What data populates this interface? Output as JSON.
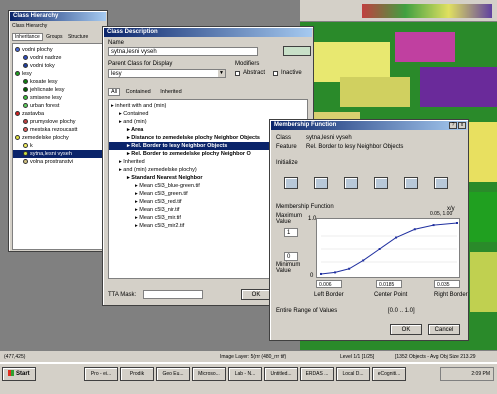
{
  "app": {
    "title": "eCognition - [...]"
  },
  "colors": {
    "titlebar": "#0a246a",
    "panel": "#d4d0c8",
    "highlight": "#0a246a"
  },
  "hierarchy": {
    "title": "Class Hierarchy",
    "menu": [
      "Class Hierarchy",
      "Classes",
      "Nearest Neighbor",
      "Edit"
    ],
    "tabs": [
      "Inheritance",
      "Groups",
      "Structure"
    ],
    "items": [
      {
        "label": "vodni plochy",
        "color": "#4a6ad8",
        "indent": 0
      },
      {
        "label": "vodni nadrze",
        "color": "#3050c0",
        "indent": 1
      },
      {
        "label": "vodni toky",
        "color": "#2040a0",
        "indent": 1
      },
      {
        "label": "lesy",
        "color": "#20a020",
        "indent": 0
      },
      {
        "label": "kosate lesy",
        "color": "#108010",
        "indent": 1
      },
      {
        "label": "jehlicnate lesy",
        "color": "#006000",
        "indent": 1
      },
      {
        "label": "smisene lesy",
        "color": "#40c040",
        "indent": 1
      },
      {
        "label": "urban forest",
        "color": "#60d060",
        "indent": 1
      },
      {
        "label": "zastavba",
        "color": "#d02020",
        "indent": 0
      },
      {
        "label": "prumyslove plochy",
        "color": "#c04040",
        "indent": 1
      },
      {
        "label": "mestska rezoucastt",
        "color": "#e06060",
        "indent": 1
      },
      {
        "label": "zemedelske plochy",
        "color": "#e0e040",
        "indent": 0
      },
      {
        "label": "k",
        "color": "#f0f060",
        "indent": 1
      },
      {
        "label": "sytna,lesni vyseh",
        "color": "#c8e040",
        "indent": 1,
        "selected": true
      },
      {
        "label": "volna prostranstvi",
        "color": "#d0c080",
        "indent": 1
      }
    ]
  },
  "classdesc": {
    "title": "Class Description",
    "name_label": "Name",
    "name_value": "sytna,lesni vyseh",
    "parent_label": "Parent Class for Display",
    "parent_value": "lesy",
    "modifiers_label": "Modifiers",
    "abstract_label": "Abstract",
    "inactive_label": "Inactive",
    "tabs": [
      "All",
      "Contained",
      "Inherited"
    ],
    "tree": [
      {
        "label": "inherit with and (min)",
        "indent": 0,
        "bold": false
      },
      {
        "label": "Contained",
        "indent": 1,
        "bold": false
      },
      {
        "label": "and (min)",
        "indent": 1,
        "bold": false
      },
      {
        "label": "Area",
        "indent": 2,
        "bold": true
      },
      {
        "label": "Distance to zemedelske plochy Neighbor Objects",
        "indent": 2,
        "bold": true
      },
      {
        "label": "Rel. Border to lesy Neighbor Objects",
        "indent": 2,
        "bold": true,
        "selected": true
      },
      {
        "label": "Rel. Border to zemedelske plochy Neighbor O",
        "indent": 2,
        "bold": true
      },
      {
        "label": "Inherited",
        "indent": 1,
        "bold": false
      },
      {
        "label": "and (min) zemedelske plochy)",
        "indent": 1,
        "bold": false
      },
      {
        "label": "Standard Nearest Neighbor",
        "indent": 2,
        "bold": true
      },
      {
        "label": "Mean c5l3_blue-green.tif",
        "indent": 3,
        "bold": false
      },
      {
        "label": "Mean c5l3_green.tif",
        "indent": 3,
        "bold": false
      },
      {
        "label": "Mean c5l3_red.tif",
        "indent": 3,
        "bold": false
      },
      {
        "label": "Mean c5l3_nir.tif",
        "indent": 3,
        "bold": false
      },
      {
        "label": "Mean c5l3_mir.tif",
        "indent": 3,
        "bold": false
      },
      {
        "label": "Mean c5l3_mir2.tif",
        "indent": 3,
        "bold": false
      }
    ],
    "tta_label": "TTA Mask:",
    "ok": "OK",
    "cancel": "Cancel"
  },
  "membership": {
    "title": "Membership Function",
    "class_label": "Class",
    "class_value": "sytna,lesni vyseh",
    "feature_label": "Feature",
    "feature_value": "Rel. Border to lesy Neighbor Objects",
    "initialize_label": "Initialize",
    "function_label": "Membership Function",
    "max_label": "Maximum Value",
    "max_value": "1",
    "min_label": "Minimum Value",
    "min_value": "0",
    "y_top": "1.0",
    "y_bottom": "0",
    "yx_label": "x/y",
    "point_label": "0.05, 1.00",
    "left_value": "0.006",
    "center_value": "0.0185",
    "right_value": "0.035",
    "left_label": "Left Border",
    "center_label": "Center Point",
    "right_label": "Right Border",
    "range_label": "Entire Range of Values",
    "range_value": "[0.0 .. 1.0]",
    "ok": "OK",
    "cancel": "Cancel"
  },
  "chart_data": {
    "type": "line",
    "x": [
      0.006,
      0.009,
      0.012,
      0.015,
      0.0185,
      0.022,
      0.026,
      0.03,
      0.035
    ],
    "y": [
      0.02,
      0.05,
      0.12,
      0.28,
      0.5,
      0.72,
      0.88,
      0.96,
      1.0
    ],
    "ylim": [
      0,
      1
    ]
  },
  "statusbar": {
    "coords": "(477,425)",
    "image_layer": "Image Layer: 5(rrr (480_rrr tif)",
    "level": "Level 1/1 [1/25]",
    "objects": "[1352 Objects - Avg Obj Size 213.29",
    "extra": ""
  },
  "taskbar": {
    "start": "Start",
    "tasks": [
      "Pro - ei...",
      "Prodik",
      "Geo Eu...",
      "Microso...",
      "Lab - N...",
      "Untitled...",
      "ERDAS ...",
      "Local D...",
      "eCogniti..."
    ],
    "clock": "2:09 PM"
  }
}
